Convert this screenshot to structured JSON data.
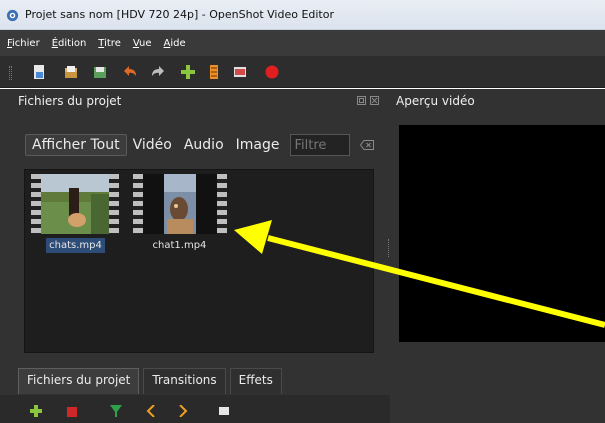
{
  "window": {
    "title": "Projet sans nom [HDV 720 24p] - OpenShot Video Editor"
  },
  "menu": {
    "items": [
      "Fichier",
      "Édition",
      "Titre",
      "Vue",
      "Aide"
    ]
  },
  "toolbar": {
    "buttons": [
      "new-project-icon",
      "open-project-icon",
      "save-project-icon",
      "undo-icon",
      "redo-icon",
      "import-files-icon",
      "choose-profile-icon",
      "fullscreen-icon",
      "export-video-icon"
    ]
  },
  "project_panel": {
    "title": "Fichiers du projet",
    "filters": [
      "Afficher Tout",
      "Vidéo",
      "Audio",
      "Image"
    ],
    "filter_placeholder": "Filtre",
    "files": [
      {
        "name": "chats.mp4",
        "selected": true
      },
      {
        "name": "chat1.mp4",
        "selected": false
      }
    ]
  },
  "bottom_tabs": [
    "Fichiers du projet",
    "Transitions",
    "Effets"
  ],
  "preview_panel": {
    "title": "Aperçu vidéo"
  },
  "colors": {
    "annotation_arrow": "#ffff00",
    "dark_bg": "#323232",
    "menubar_bg": "#3a3a3a",
    "selection": "#2d4d78"
  }
}
